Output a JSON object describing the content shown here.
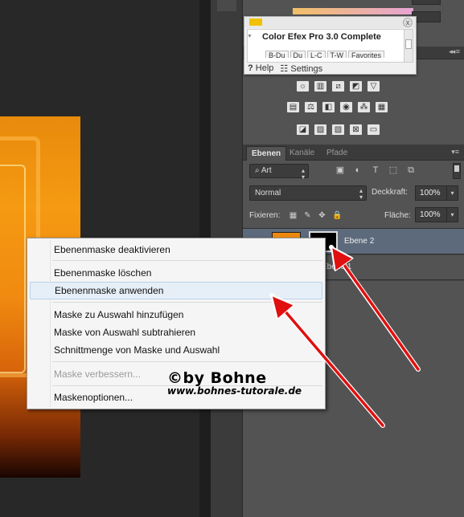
{
  "color_efex": {
    "title": "Color Efex Pro 3.0 Complete",
    "close_glyph": "x",
    "tabs": [
      "B-Du",
      "Du",
      "L-C",
      "T-W",
      "Favorites"
    ],
    "help_label": "Help",
    "settings_label": "Settings"
  },
  "layers_panel": {
    "tabs": [
      "Ebenen",
      "Kanäle",
      "Pfade"
    ],
    "filter_value": "Art",
    "blend_mode": "Normal",
    "opacity_label": "Deckkraft:",
    "opacity_value": "100%",
    "lock_label": "Fixieren:",
    "fill_label": "Fläche:",
    "fill_value": "100%",
    "layers": [
      {
        "name": "Ebene 2",
        "selected": true
      },
      {
        "name": "Ebene 1",
        "selected": false
      }
    ]
  },
  "context_menu": {
    "items": [
      {
        "label": "Ebenenmaske deaktivieren",
        "disabled": false
      },
      {
        "label": "Ebenenmaske löschen",
        "disabled": false
      },
      {
        "label": "Ebenenmaske anwenden",
        "disabled": false,
        "hover": true
      },
      {
        "label": "Maske zu Auswahl hinzufügen",
        "disabled": false
      },
      {
        "label": "Maske von Auswahl subtrahieren",
        "disabled": false
      },
      {
        "label": "Schnittmenge von Maske und Auswahl",
        "disabled": false
      },
      {
        "label": "Maske verbessern...",
        "disabled": true
      },
      {
        "label": "Maskenoptionen...",
        "disabled": false
      }
    ]
  },
  "watermark": {
    "line1": "©by Bohne",
    "line2": "www.bohnes-tutorale.de"
  },
  "colors": {
    "arrow": "#e01010",
    "panel_bg": "#535353",
    "selected_layer": "#5d6a7b",
    "menu_hover": "#e6eff7"
  }
}
